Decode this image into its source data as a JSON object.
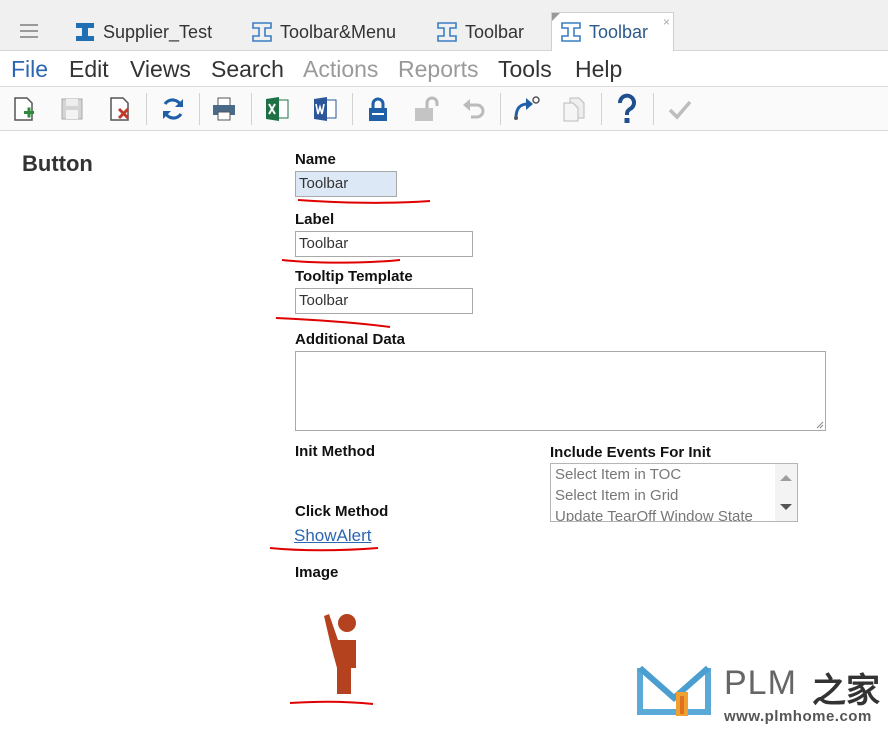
{
  "tabs": [
    {
      "label": "Supplier_Test",
      "active": false
    },
    {
      "label": "Toolbar&Menu",
      "active": false
    },
    {
      "label": "Toolbar",
      "active": false
    },
    {
      "label": "Toolbar",
      "active": true
    }
  ],
  "tab_close_glyph": "×",
  "menu": {
    "file": "File",
    "edit": "Edit",
    "views": "Views",
    "search": "Search",
    "actions": "Actions",
    "reports": "Reports",
    "tools": "Tools",
    "help": "Help"
  },
  "toolbar_icons": [
    "new-item-icon",
    "save-icon",
    "delete-icon",
    "refresh-icon",
    "print-icon",
    "export-excel-icon",
    "export-word-icon",
    "lock-icon",
    "unlock-icon",
    "undo-icon",
    "promote-icon",
    "copy-icon",
    "help-icon",
    "done-icon"
  ],
  "form": {
    "section_title": "Button",
    "name_label": "Name",
    "name_value": "Toolbar",
    "label_label": "Label",
    "label_value": "Toolbar",
    "tooltip_label": "Tooltip Template",
    "tooltip_value": "Toolbar",
    "additional_data_label": "Additional Data",
    "additional_data_value": "",
    "init_method_label": "Init Method",
    "include_events_label": "Include Events For Init",
    "include_events_options": [
      "Select Item in TOC",
      "Select Item in Grid",
      "Update TearOff Window State"
    ],
    "click_method_label": "Click Method",
    "click_method_value": "ShowAlert",
    "image_label": "Image"
  },
  "watermark": {
    "brand": "PLM",
    "brand_cn": "之家",
    "url": "www.plmhome.com"
  },
  "colors": {
    "accent": "#2c66b0",
    "excel": "#1e7145",
    "word": "#2b579a",
    "delete": "#c0392b",
    "image": "#b5421f",
    "annotation": "#e00000"
  }
}
